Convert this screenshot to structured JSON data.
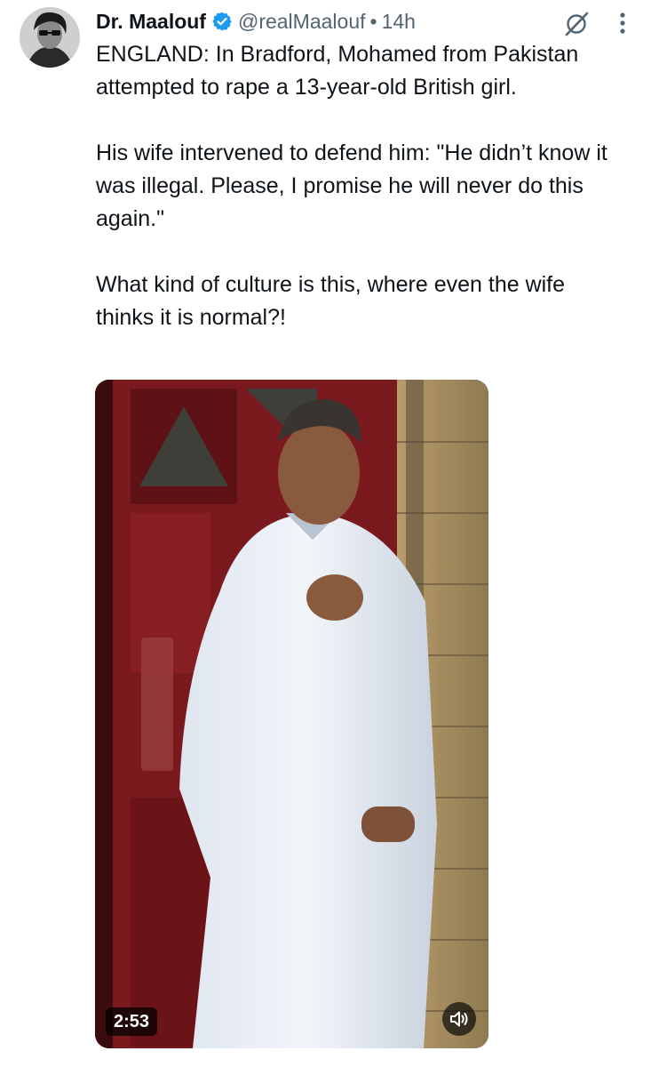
{
  "author": {
    "display_name": "Dr. Maalouf",
    "handle": "@realMaalouf",
    "separator": "•",
    "time": "14h",
    "verified_color": "#1d9bf0"
  },
  "icons": {
    "verified": "verified-badge-icon",
    "grok": "grok-icon",
    "more": "more-options-icon",
    "mute": "volume-icon"
  },
  "tweet": {
    "paragraphs": [
      "ENGLAND: In Bradford, Mohamed from Pakistan attempted to rape a 13-year-old British girl.",
      "His wife intervened to defend him: \"He didn’t know it was illegal. Please, I promise he will never do this again.\"",
      "What kind of culture is this, where even the wife thinks it is normal?!"
    ]
  },
  "video": {
    "duration": "2:53"
  }
}
